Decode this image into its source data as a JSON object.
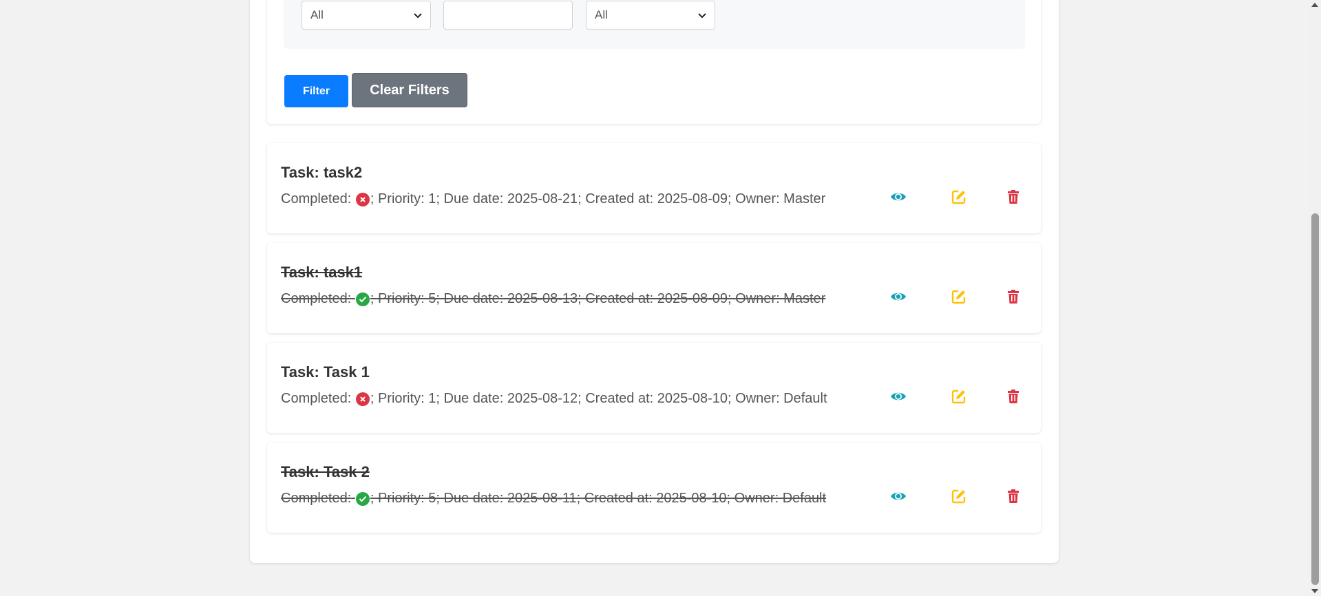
{
  "filters": {
    "status_select": "All",
    "text_input": "",
    "priority_select": "All",
    "filter_label": "Filter",
    "clear_label": "Clear Filters"
  },
  "colors": {
    "primary": "#0a7cff",
    "secondary": "#6c757d",
    "view": "#17a2b8",
    "edit": "#ffc107",
    "delete": "#dc3545",
    "incomplete": "#dc3545",
    "complete": "#28a745"
  },
  "tasks": [
    {
      "title": "Task: task2",
      "completed_label": "Completed:",
      "completed": false,
      "details": "; Priority: 1; Due date: 2025-08-21; Created at: 2025-08-09; Owner: Master"
    },
    {
      "title": "Task: task1",
      "completed_label": "Completed:",
      "completed": true,
      "details": "; Priority: 5; Due date: 2025-08-13; Created at: 2025-08-09; Owner: Master"
    },
    {
      "title": "Task: Task 1",
      "completed_label": "Completed:",
      "completed": false,
      "details": "; Priority: 1; Due date: 2025-08-12; Created at: 2025-08-10; Owner: Default"
    },
    {
      "title": "Task: Task 2",
      "completed_label": "Completed:",
      "completed": true,
      "details": "; Priority: 5; Due date: 2025-08-11; Created at: 2025-08-10; Owner: Default"
    }
  ],
  "icons": {
    "view": "eye-icon",
    "edit": "edit-icon",
    "delete": "trash-icon",
    "incomplete": "x-circle-icon",
    "complete": "check-circle-icon"
  }
}
